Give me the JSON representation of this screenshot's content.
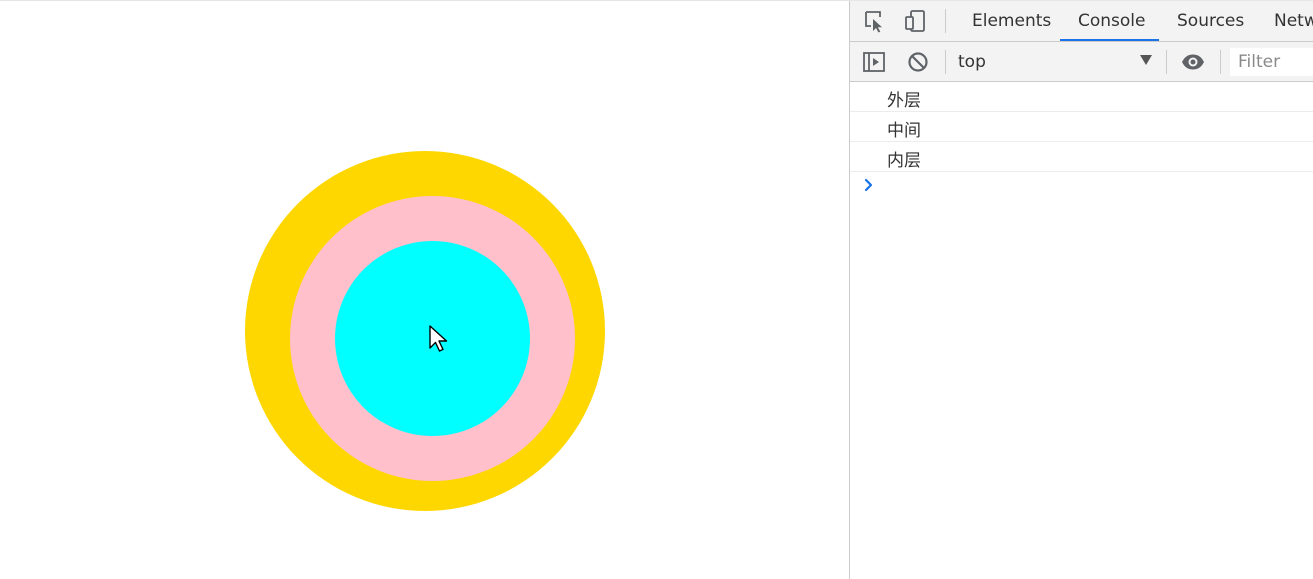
{
  "viewport": {
    "circles": [
      {
        "name": "outer",
        "color": "#FFD700"
      },
      {
        "name": "middle",
        "color": "#FFC0CB"
      },
      {
        "name": "inner",
        "color": "#00FFFF"
      }
    ]
  },
  "devtools": {
    "toolbar_icons": [
      "inspect-element-icon",
      "device-toolbar-icon"
    ],
    "tabs": [
      {
        "label": "Elements",
        "active": false
      },
      {
        "label": "Console",
        "active": true
      },
      {
        "label": "Sources",
        "active": false
      },
      {
        "label": "Network",
        "active": false
      }
    ],
    "accent_color": "#1a73e8",
    "console_toolbar": {
      "sidebar_toggle_icon": "sidebar-toggle-icon",
      "clear_icon": "clear-console-icon",
      "context": "top",
      "eye_icon": "live-expression-eye-icon",
      "filter_placeholder": "Filter"
    },
    "console_messages": [
      "外层",
      "中间",
      "内层"
    ],
    "prompt_icon": "prompt-chevron-icon"
  }
}
